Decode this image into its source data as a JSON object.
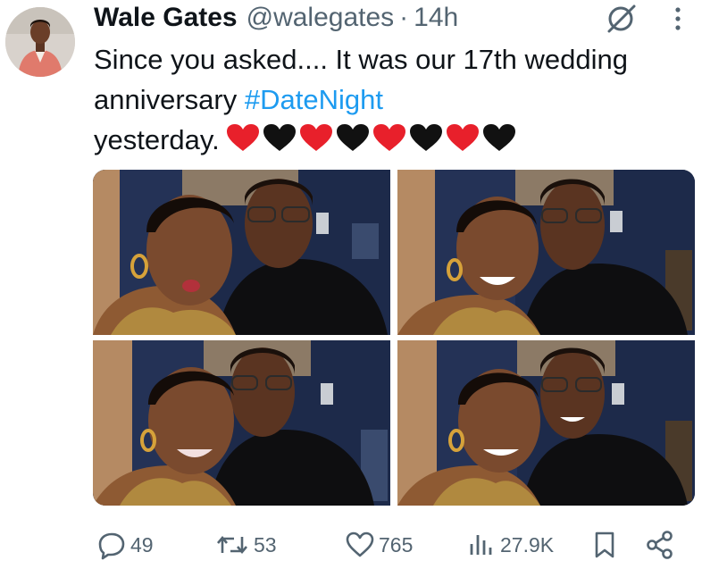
{
  "tweet": {
    "author_name": "Wale Gates",
    "handle": "@walegates",
    "separator": "·",
    "time": "14h",
    "text_before": "Since you asked.... It was our 17th wedding anniversary ",
    "hashtag": "#DateNight",
    "text_after": " yesterday.",
    "emoji_sequence": [
      "red-heart",
      "black-heart",
      "red-heart",
      "black-heart",
      "red-heart",
      "black-heart",
      "red-heart",
      "black-heart"
    ],
    "photos": [
      "selfie couple photo 1",
      "selfie couple photo 2",
      "selfie couple photo 3",
      "selfie couple photo 4"
    ]
  },
  "actions": {
    "replies": "49",
    "reposts": "53",
    "likes": "765",
    "views": "27.9K"
  },
  "colors": {
    "text": "#0f1419",
    "secondary": "#536471",
    "hashtag": "#1d9bf0",
    "red_heart": "#e8202b",
    "black_heart": "#111111"
  },
  "icons": {
    "grok": "grok-icon",
    "more": "more-icon",
    "reply": "reply-icon",
    "repost": "repost-icon",
    "like": "heart-icon",
    "views": "views-icon",
    "bookmark": "bookmark-icon",
    "share": "share-icon"
  }
}
